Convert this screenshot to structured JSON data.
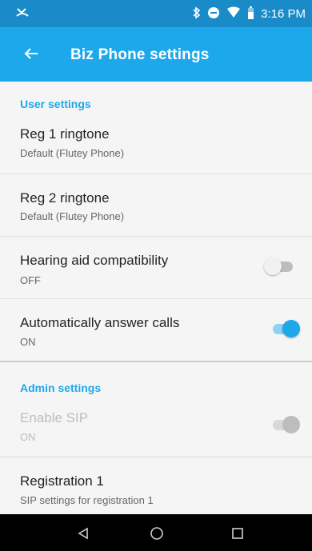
{
  "status_bar": {
    "left_icon": "missed-call-icon",
    "icons": [
      "bluetooth-icon",
      "do-not-disturb-icon",
      "wifi-icon",
      "battery-icon"
    ],
    "time": "3:16 PM"
  },
  "app_bar": {
    "back_icon": "arrow-left-icon",
    "title": "Biz Phone settings"
  },
  "sections": {
    "user": {
      "header": "User settings",
      "reg1": {
        "title": "Reg 1 ringtone",
        "summary": "Default (Flutey Phone)"
      },
      "reg2": {
        "title": "Reg 2 ringtone",
        "summary": "Default (Flutey Phone)"
      },
      "hearing": {
        "title": "Hearing aid compatibility",
        "summary": "OFF",
        "enabled": false
      },
      "autoanswer": {
        "title": "Automatically answer calls",
        "summary": "ON",
        "enabled": true
      }
    },
    "admin": {
      "header": "Admin settings",
      "sip": {
        "title": "Enable SIP",
        "summary": "ON",
        "enabled": true,
        "disabled": true
      },
      "registration1": {
        "title": "Registration 1",
        "summary": "SIP settings for registration 1"
      }
    }
  },
  "nav_bar": {
    "buttons": [
      "back-triangle-icon",
      "home-circle-icon",
      "recents-square-icon"
    ]
  },
  "colors": {
    "status_bar": "#1a8bc9",
    "app_bar": "#1ea8ec",
    "accent": "#1ea8ec",
    "background": "#f5f5f5"
  }
}
